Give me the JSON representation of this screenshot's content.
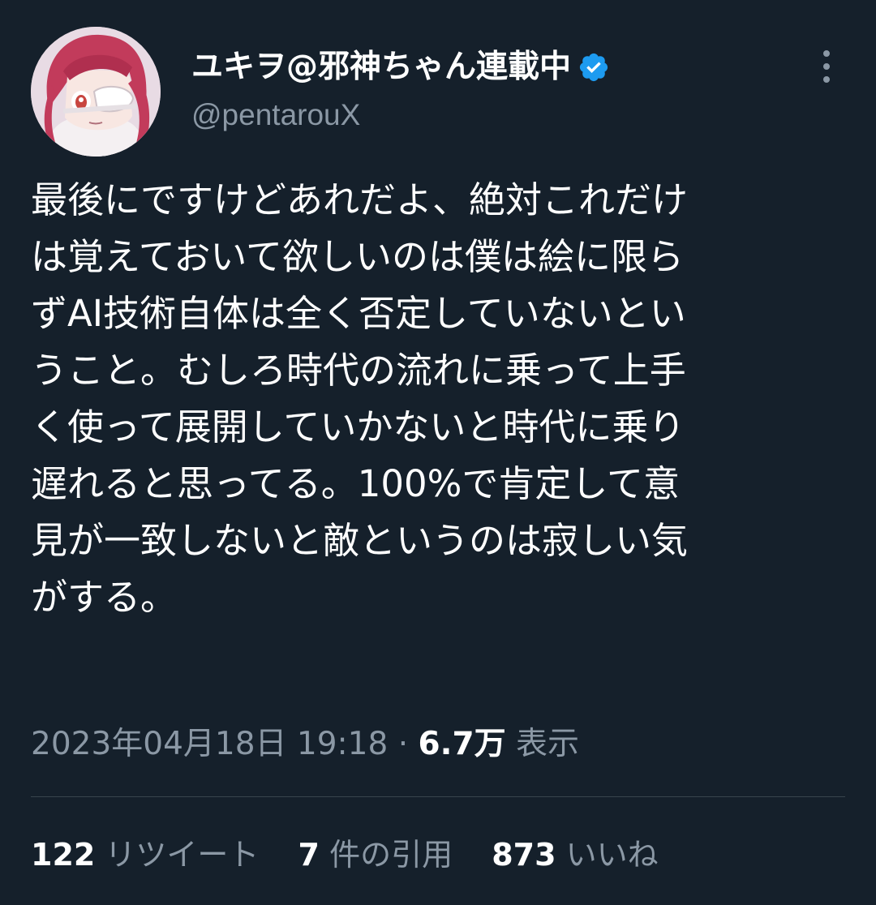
{
  "author": {
    "display_name": "ユキヲ@邪神ちゃん連載中",
    "handle": "@pentarouX",
    "verified": true,
    "avatar_icon": "avatar-image"
  },
  "tweet": {
    "text": "最後にですけどあれだよ、絶対これだけ\nは覚えておいて欲しいのは僕は絵に限ら\nずAI技術自体は全く否定していないとい\nうこと。むしろ時代の流れに乗って上手\nく使って展開していかないと時代に乗り\n遅れると思ってる。100%で肯定して意\n見が一致しないと敵というのは寂しい気\nがする。"
  },
  "meta": {
    "timestamp": "2023年04月18日 19:18",
    "separator": "·",
    "views_count": "6.7万",
    "views_label": "表示"
  },
  "stats": {
    "retweets_count": "122",
    "retweets_label": "リツイート",
    "quotes_count": "7",
    "quotes_label": "件の引用",
    "likes_count": "873",
    "likes_label": "いいね"
  },
  "colors": {
    "background": "#15202b",
    "secondary_text": "#8b98a5",
    "verified_badge": "#1d9bf0",
    "divider": "#38444d"
  }
}
